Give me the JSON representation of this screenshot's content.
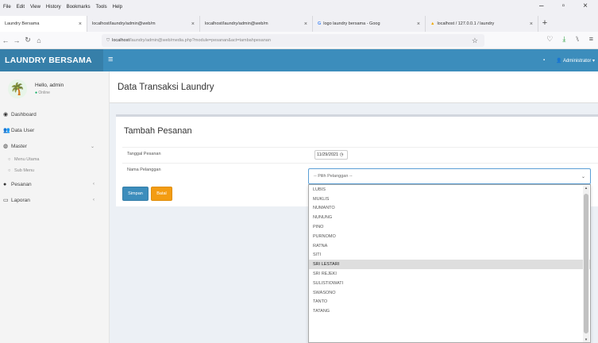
{
  "browser": {
    "menu": [
      "File",
      "Edit",
      "View",
      "History",
      "Bookmarks",
      "Tools",
      "Help"
    ],
    "tabs": [
      {
        "title": "Laundry Bersama",
        "active": true
      },
      {
        "title": "localhost/laundry/admin@web/m",
        "active": false
      },
      {
        "title": "localhost/laundry/admin@web/m",
        "active": false
      },
      {
        "title": "logo laundry bersama - Goog",
        "active": false
      },
      {
        "title": "localhost / 127.0.0.1 / laundry",
        "active": false
      }
    ],
    "url_host": "localhost",
    "url_path": "/laundry/admin@web/media.php?module=pesanan&act=tambahpesanan"
  },
  "header": {
    "logo": "LAUNDRY BERSAMA",
    "user_menu": "Administrator"
  },
  "sidebar": {
    "user_name": "Hello, admin",
    "user_status": "Online",
    "items": [
      {
        "label": "Dashboard",
        "icon": "dashboard-icon",
        "glyph": "◉"
      },
      {
        "label": "Data User",
        "icon": "users-icon",
        "glyph": "👥"
      },
      {
        "label": "Master",
        "icon": "database-icon",
        "glyph": "◍",
        "caret": "⌄"
      },
      {
        "label": "Pesanan",
        "icon": "circle-icon",
        "glyph": "●",
        "caret": "‹"
      },
      {
        "label": "Laporan",
        "icon": "folder-icon",
        "glyph": "▭",
        "caret": "‹"
      }
    ],
    "subitems": [
      "Menu Utama",
      "Sub Menu"
    ]
  },
  "content": {
    "page_title": "Data Transaksi Laundry",
    "form_title": "Tambah Pesanan",
    "date_label": "Tanggal Pesanan",
    "date_value": "11/29/2021",
    "customer_label": "Nama Pelanggan",
    "select_placeholder": "-- Pilih Pelanggan --",
    "save_label": "Simpan",
    "cancel_label": "Batal"
  },
  "dropdown": {
    "options": [
      "LUBIS",
      "MUKLIS",
      "NUMANTO",
      "NUNUNG",
      "PINO",
      "PURNOMO",
      "RATNA",
      "SITI",
      "SRI LESTARI",
      "SRI REJEKI",
      "SULISTIOWATI",
      "SWASONO",
      "TANTO",
      "TATANG"
    ],
    "selected": "SRI LESTARI"
  },
  "colors": {
    "header": "#3c8dbc",
    "logo_bg": "#367fa9",
    "save_button": "#3c8dbc",
    "cancel_button": "#f39c12",
    "online_dot": "#00a65a"
  }
}
